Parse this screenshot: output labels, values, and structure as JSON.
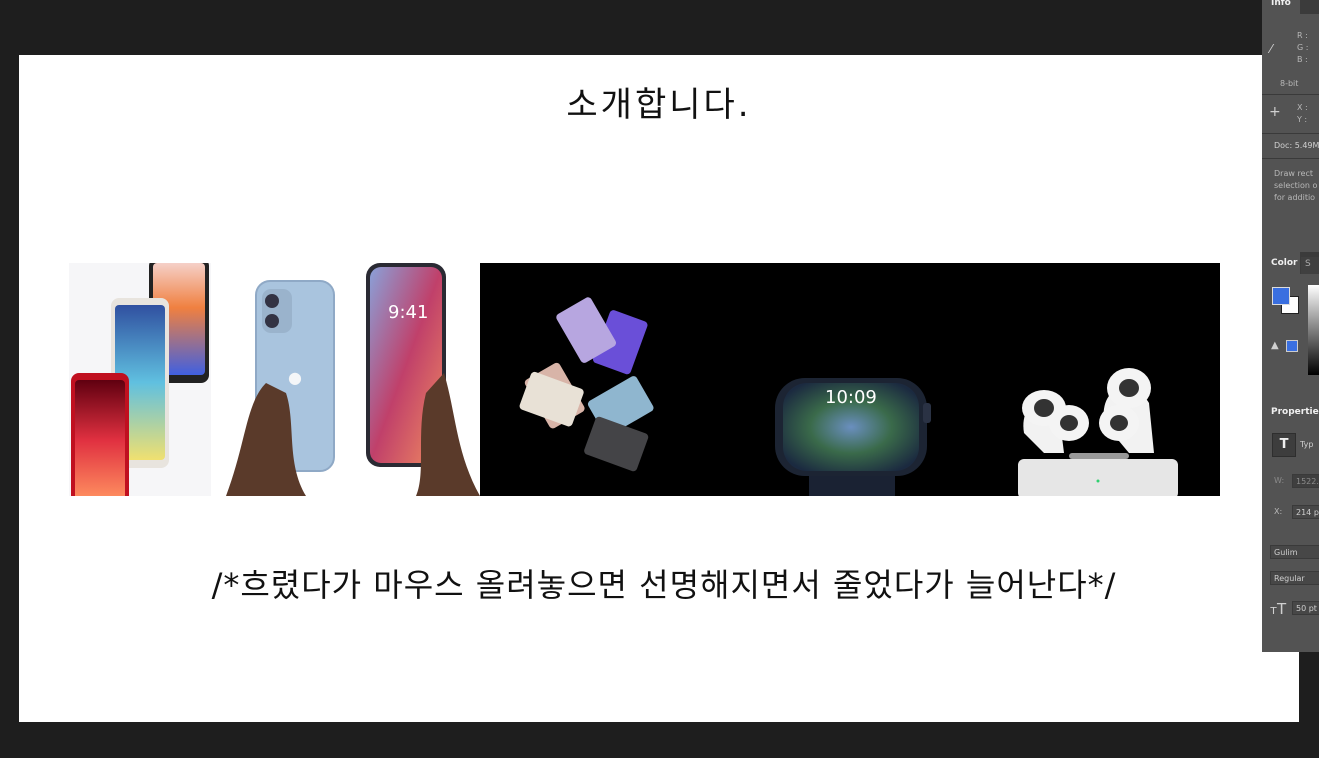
{
  "canvas": {
    "heading": "소개합니다.",
    "caption": "/*흐렸다가 마우스 올려놓으면 선명해지면서 줄었다가 늘어난다*/",
    "images": [
      {
        "name": "iphone-se-image",
        "desc_icon": "iphone-se"
      },
      {
        "name": "iphone-14-image",
        "desc_icon": "iphone-14"
      },
      {
        "name": "ipad-air-image",
        "desc_icon": "ipad"
      },
      {
        "name": "apple-watch-image",
        "desc_icon": "watch"
      },
      {
        "name": "airpods-pro-image",
        "desc_icon": "airpods"
      }
    ],
    "watch_time": "10:09",
    "phone_time": "9:41"
  },
  "panel": {
    "info_tab": "Info",
    "rgb": {
      "r": "R :",
      "g": "G :",
      "b": "B :"
    },
    "bit_depth": "8-bit",
    "xy": {
      "x": "X :",
      "y": "Y :"
    },
    "doc": "Doc: 5.49M",
    "hint": [
      "Draw rect",
      "selection o",
      "for additio"
    ],
    "color_tab": "Color",
    "color_tab2": "S",
    "foreground_color": "#3a6fe0",
    "background_color": "#ffffff",
    "properties_tab": "Properties",
    "type_label": "Typ",
    "w_label": "W:",
    "w_value": "1522.",
    "x_label": "X:",
    "x_value": "214 p",
    "font_family": "Gulim",
    "font_style": "Regular",
    "font_size": "50 pt"
  }
}
